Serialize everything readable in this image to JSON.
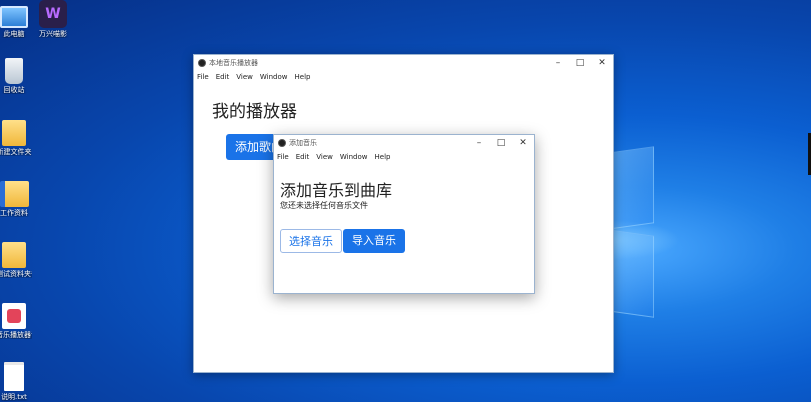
{
  "desktop": {
    "icons": [
      {
        "label": "此电脑",
        "icon": "computer-icon"
      },
      {
        "label": "万兴喵影",
        "icon": "video-editor-app-icon"
      },
      {
        "label": "回收站",
        "icon": "recycle-bin-icon"
      },
      {
        "label": "新建文件夹",
        "icon": "folder-icon"
      },
      {
        "label": "工作资料",
        "icon": "folder-icon"
      },
      {
        "label": "测试资料夹备份",
        "icon": "folder-icon"
      },
      {
        "label": "音乐播放器说明文档.pdf",
        "icon": "pdf-icon"
      },
      {
        "label": "说明.txt",
        "icon": "document-icon"
      }
    ]
  },
  "main_window": {
    "title": "本地音乐播放器",
    "menu": [
      "File",
      "Edit",
      "View",
      "Window",
      "Help"
    ],
    "heading": "我的播放器",
    "add_button": "添加歌曲"
  },
  "dialog": {
    "title": "添加音乐",
    "menu": [
      "File",
      "Edit",
      "View",
      "Window",
      "Help"
    ],
    "heading": "添加音乐到曲库",
    "subtitle": "您还未选择任何音乐文件",
    "select_button": "选择音乐",
    "import_button": "导入音乐"
  },
  "controls": {
    "minimize": "–",
    "maximize": "□",
    "close": "✕"
  },
  "colors": {
    "accent": "#1a73e8",
    "desktop": "#0b5fd1"
  }
}
